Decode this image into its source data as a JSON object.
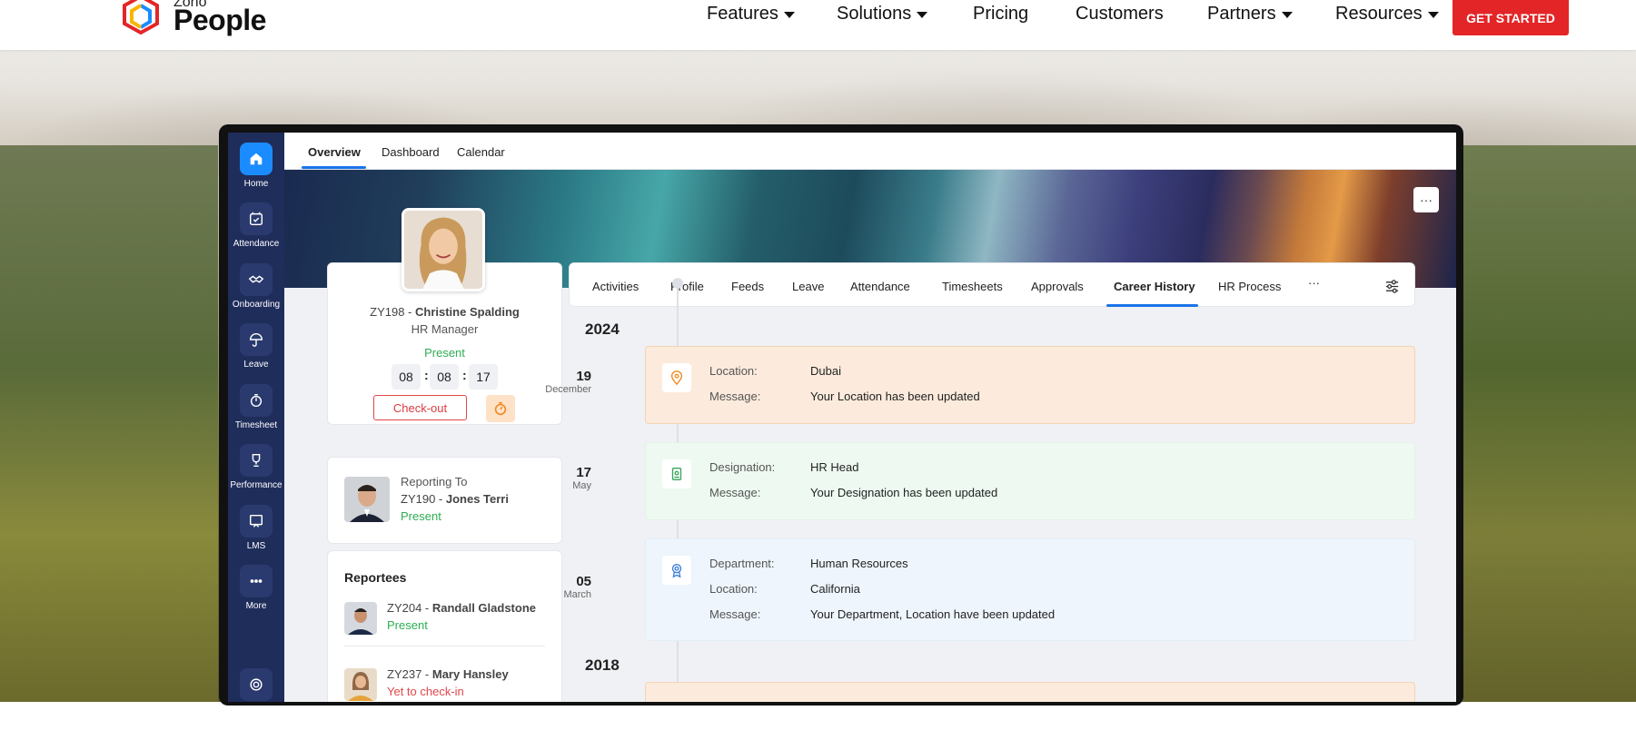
{
  "nav": {
    "logo_small": "Zoho",
    "logo_big": "People",
    "items": [
      {
        "label": "Features",
        "dropdown": true
      },
      {
        "label": "Solutions",
        "dropdown": true
      },
      {
        "label": "Pricing",
        "dropdown": false
      },
      {
        "label": "Customers",
        "dropdown": false
      },
      {
        "label": "Partners",
        "dropdown": true
      },
      {
        "label": "Resources",
        "dropdown": true
      }
    ],
    "cta": "GET STARTED"
  },
  "sidebar": {
    "items": [
      {
        "label": "Home",
        "icon": "home-icon",
        "active": true
      },
      {
        "label": "Attendance",
        "icon": "calendar-check-icon"
      },
      {
        "label": "Onboarding",
        "icon": "handshake-icon"
      },
      {
        "label": "Leave",
        "icon": "umbrella-icon"
      },
      {
        "label": "Timesheet",
        "icon": "stopwatch-icon"
      },
      {
        "label": "Performance",
        "icon": "trophy-icon"
      },
      {
        "label": "LMS",
        "icon": "board-icon"
      },
      {
        "label": "More",
        "icon": "more-icon"
      }
    ]
  },
  "top_tabs": [
    {
      "label": "Overview",
      "active": true
    },
    {
      "label": "Dashboard"
    },
    {
      "label": "Calendar"
    }
  ],
  "banner_more": "···",
  "profile": {
    "id": "ZY198 - ",
    "name": "Christine Spalding",
    "role": "HR Manager",
    "status": "Present",
    "time": {
      "h": "08",
      "m": "08",
      "s": "17"
    },
    "checkout_label": "Check-out"
  },
  "reporting": {
    "heading": "Reporting To",
    "id": "ZY190 - ",
    "name": "Jones Terri",
    "status": "Present"
  },
  "reportees": {
    "heading": "Reportees",
    "items": [
      {
        "id": "ZY204 - ",
        "name": "Randall Gladstone",
        "status": "Present"
      },
      {
        "id": "ZY237 - ",
        "name": "Mary Hansley",
        "status": "Yet to check-in"
      }
    ]
  },
  "sub_tabs": [
    {
      "label": "Activities"
    },
    {
      "label": "Profile"
    },
    {
      "label": "Feeds"
    },
    {
      "label": "Leave"
    },
    {
      "label": "Attendance"
    },
    {
      "label": "Timesheets"
    },
    {
      "label": "Approvals"
    },
    {
      "label": "Career History",
      "active": true
    },
    {
      "label": "HR Process"
    },
    {
      "label": "···"
    }
  ],
  "timeline": {
    "years": [
      "2024",
      "2018"
    ],
    "entries": [
      {
        "day": "19",
        "month": "December",
        "color": "orange",
        "icon": "location-pin-icon",
        "rows": [
          {
            "k": "Location:",
            "v": "Dubai"
          },
          {
            "k": "Message:",
            "v": "Your Location has been updated"
          }
        ]
      },
      {
        "day": "17",
        "month": "May",
        "color": "green",
        "icon": "id-badge-icon",
        "rows": [
          {
            "k": "Designation:",
            "v": "HR Head"
          },
          {
            "k": "Message:",
            "v": "Your Designation has been updated"
          }
        ]
      },
      {
        "day": "05",
        "month": "March",
        "color": "blue",
        "icon": "award-icon",
        "rows": [
          {
            "k": "Department:",
            "v": "Human Resources"
          },
          {
            "k": "Location:",
            "v": "California"
          },
          {
            "k": "Message:",
            "v": "Your Department, Location have been updated"
          }
        ]
      }
    ]
  }
}
